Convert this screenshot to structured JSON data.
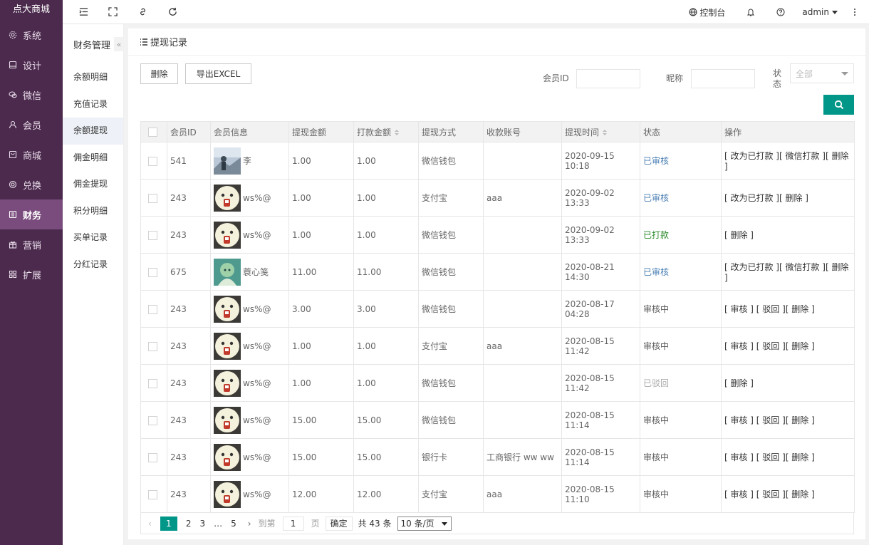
{
  "app": {
    "brand": "点大商城"
  },
  "sidebar": {
    "items": [
      {
        "label": "系统",
        "icon": "gear-icon"
      },
      {
        "label": "设计",
        "icon": "monitor-icon"
      },
      {
        "label": "微信",
        "icon": "wechat-icon"
      },
      {
        "label": "会员",
        "icon": "user-icon"
      },
      {
        "label": "商城",
        "icon": "store-icon"
      },
      {
        "label": "兑换",
        "icon": "coin-icon"
      },
      {
        "label": "财务",
        "icon": "finance-icon"
      },
      {
        "label": "营销",
        "icon": "gift-icon"
      },
      {
        "label": "扩展",
        "icon": "grid-icon"
      }
    ],
    "active_index": 6
  },
  "header": {
    "console": "控制台",
    "user": "admin"
  },
  "subnav": {
    "title": "财务管理",
    "collapse": "«",
    "items": [
      "余额明细",
      "充值记录",
      "余额提现",
      "佣金明细",
      "佣金提现",
      "积分明细",
      "买单记录",
      "分红记录"
    ],
    "active_index": 2
  },
  "panel": {
    "title": "提现记录",
    "delete_btn": "删除",
    "export_btn": "导出EXCEL",
    "filter_member_id": "会员ID",
    "filter_nickname": "昵称",
    "filter_status_label": "状 态",
    "filter_status_value": "全部"
  },
  "table": {
    "headers": [
      "会员ID",
      "会员信息",
      "提现金额",
      "打款金额",
      "提现方式",
      "收款账号",
      "提现时间",
      "状态",
      "操作"
    ],
    "rows": [
      {
        "id": "541",
        "name": "李",
        "avatar": "photo",
        "amount": "1.00",
        "paid": "1.00",
        "method": "微信钱包",
        "account": "",
        "time": "2020-09-15 10:18",
        "status": "已审核",
        "status_kind": "review",
        "ops": "[ 改为已打款 ][ 微信打款 ][ 删除 ]"
      },
      {
        "id": "243",
        "name": "ws%@",
        "avatar": "cartoon",
        "amount": "1.00",
        "paid": "1.00",
        "method": "支付宝",
        "account": "aaa",
        "time": "2020-09-02 13:33",
        "status": "已审核",
        "status_kind": "review",
        "ops": "[ 改为已打款 ][ 删除 ]"
      },
      {
        "id": "243",
        "name": "ws%@",
        "avatar": "cartoon",
        "amount": "1.00",
        "paid": "1.00",
        "method": "微信钱包",
        "account": "",
        "time": "2020-09-02 13:33",
        "status": "已打款",
        "status_kind": "paid",
        "ops": "[ 删除 ]"
      },
      {
        "id": "675",
        "name": "蓑心笺",
        "avatar": "anime",
        "amount": "11.00",
        "paid": "11.00",
        "method": "微信钱包",
        "account": "",
        "time": "2020-08-21 14:30",
        "status": "已审核",
        "status_kind": "review",
        "ops": "[ 改为已打款 ][ 微信打款 ][ 删除 ]"
      },
      {
        "id": "243",
        "name": "ws%@",
        "avatar": "cartoon",
        "amount": "3.00",
        "paid": "3.00",
        "method": "微信钱包",
        "account": "",
        "time": "2020-08-17 04:28",
        "status": "审核中",
        "status_kind": "pending",
        "ops": "[ 审核 ] [ 驳回 ][ 删除 ]"
      },
      {
        "id": "243",
        "name": "ws%@",
        "avatar": "cartoon",
        "amount": "1.00",
        "paid": "1.00",
        "method": "支付宝",
        "account": "aaa",
        "time": "2020-08-15 11:42",
        "status": "审核中",
        "status_kind": "pending",
        "ops": "[ 审核 ] [ 驳回 ][ 删除 ]"
      },
      {
        "id": "243",
        "name": "ws%@",
        "avatar": "cartoon",
        "amount": "1.00",
        "paid": "1.00",
        "method": "微信钱包",
        "account": "",
        "time": "2020-08-15 11:42",
        "status": "已驳回",
        "status_kind": "rejected",
        "ops": "[ 删除 ]"
      },
      {
        "id": "243",
        "name": "ws%@",
        "avatar": "cartoon",
        "amount": "15.00",
        "paid": "15.00",
        "method": "微信钱包",
        "account": "",
        "time": "2020-08-15 11:14",
        "status": "审核中",
        "status_kind": "pending",
        "ops": "[ 审核 ] [ 驳回 ][ 删除 ]"
      },
      {
        "id": "243",
        "name": "ws%@",
        "avatar": "cartoon",
        "amount": "15.00",
        "paid": "15.00",
        "method": "银行卡",
        "account": "工商银行 ww ww",
        "time": "2020-08-15 11:14",
        "status": "审核中",
        "status_kind": "pending",
        "ops": "[ 审核 ] [ 驳回 ][ 删除 ]"
      },
      {
        "id": "243",
        "name": "ws%@",
        "avatar": "cartoon",
        "amount": "12.00",
        "paid": "12.00",
        "method": "支付宝",
        "account": "aaa",
        "time": "2020-08-15 11:10",
        "status": "审核中",
        "status_kind": "pending",
        "ops": "[ 审核 ] [ 驳回 ][ 删除 ]"
      }
    ]
  },
  "pager": {
    "pages": [
      "1",
      "2",
      "3",
      "…",
      "5"
    ],
    "goto_label": "到第",
    "goto_value": "1",
    "page_unit": "页",
    "confirm": "确定",
    "total": "共 43 条",
    "size": "10 条/页"
  },
  "colors": {
    "sidebar_bg": "#4b2a4d",
    "sidebar_active": "#7a4c7d",
    "accent": "#009688",
    "status_review": "#4a7fb3",
    "status_paid": "#2b8a2b"
  }
}
